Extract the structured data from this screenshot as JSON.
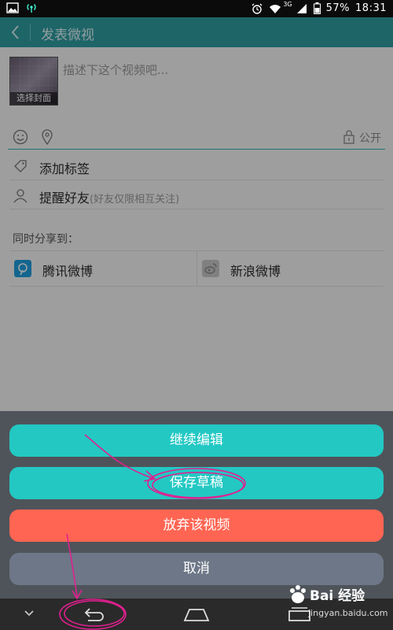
{
  "status_bar": {
    "battery": "57%",
    "time": "18:31",
    "network": "3G"
  },
  "header": {
    "title": "发表微视",
    "back_icon": "back-chevron-icon"
  },
  "composer": {
    "cover_label": "选择封面",
    "description_placeholder": "描述下这个视频吧...",
    "privacy_label": "公开"
  },
  "rows": {
    "add_tag": "添加标签",
    "remind_friends": "提醒好友",
    "remind_hint": "(好友仅限相互关注)"
  },
  "share": {
    "title": "同时分享到：",
    "tencent": "腾讯微博",
    "sina": "新浪微博"
  },
  "sheet": {
    "continue_edit": "继续编辑",
    "save_draft": "保存草稿",
    "discard": "放弃该视频",
    "cancel": "取消"
  },
  "colors": {
    "header": "#2f9fa3",
    "teal_button": "#23c8c3",
    "red_button": "#ff6552",
    "gray_button": "#6d7787",
    "annotation": "#e0208f"
  },
  "watermark": {
    "brand": "Bai 经验",
    "url": "jingyan.baidu.com"
  }
}
